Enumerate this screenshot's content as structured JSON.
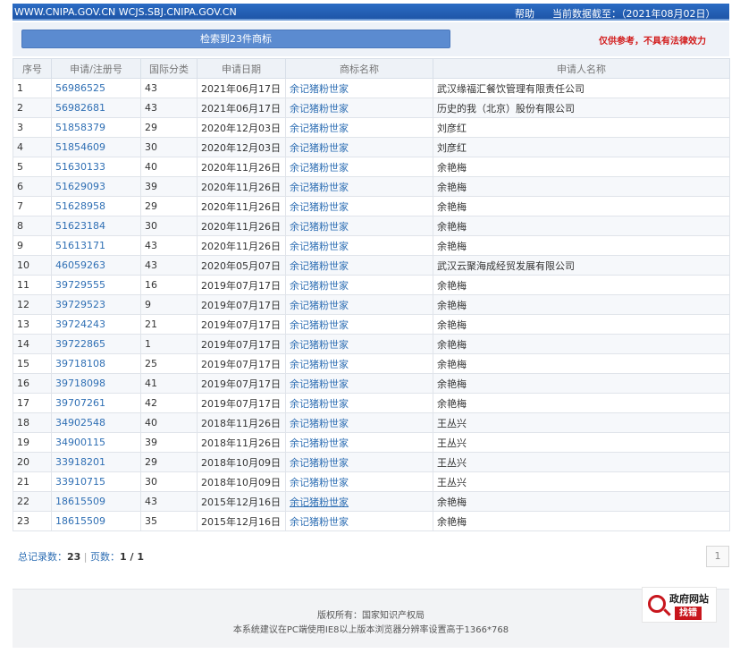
{
  "header": {
    "site": "WWW.CNIPA.GOV.CN WCJS.SBJ.CNIPA.GOV.CN",
    "help": "帮助",
    "as_of": "当前数据截至：（2021年08月02日）"
  },
  "search": {
    "result_label": "检索到23件商标",
    "disclaimer": "仅供参考，不具有法律效力"
  },
  "table": {
    "headers": [
      "序号",
      "申请/注册号",
      "国际分类",
      "申请日期",
      "商标名称",
      "申请人名称"
    ],
    "rows": [
      [
        "1",
        "56986525",
        "43",
        "2021年06月17日",
        "余记猪粉世家",
        "武汉缘福汇餐饮管理有限责任公司"
      ],
      [
        "2",
        "56982681",
        "43",
        "2021年06月17日",
        "余记猪粉世家",
        "历史的我（北京）股份有限公司"
      ],
      [
        "3",
        "51858379",
        "29",
        "2020年12月03日",
        "余记猪粉世家",
        "刘彦红"
      ],
      [
        "4",
        "51854609",
        "30",
        "2020年12月03日",
        "余记猪粉世家",
        "刘彦红"
      ],
      [
        "5",
        "51630133",
        "40",
        "2020年11月26日",
        "余记猪粉世家",
        "余艳梅"
      ],
      [
        "6",
        "51629093",
        "39",
        "2020年11月26日",
        "余记猪粉世家",
        "余艳梅"
      ],
      [
        "7",
        "51628958",
        "29",
        "2020年11月26日",
        "余记猪粉世家",
        "余艳梅"
      ],
      [
        "8",
        "51623184",
        "30",
        "2020年11月26日",
        "余记猪粉世家",
        "余艳梅"
      ],
      [
        "9",
        "51613171",
        "43",
        "2020年11月26日",
        "余记猪粉世家",
        "余艳梅"
      ],
      [
        "10",
        "46059263",
        "43",
        "2020年05月07日",
        "余记猪粉世家",
        "武汉云聚海成经贸发展有限公司"
      ],
      [
        "11",
        "39729555",
        "16",
        "2019年07月17日",
        "余记猪粉世家",
        "余艳梅"
      ],
      [
        "12",
        "39729523",
        "9",
        "2019年07月17日",
        "余记猪粉世家",
        "余艳梅"
      ],
      [
        "13",
        "39724243",
        "21",
        "2019年07月17日",
        "余记猪粉世家",
        "余艳梅"
      ],
      [
        "14",
        "39722865",
        "1",
        "2019年07月17日",
        "余记猪粉世家",
        "余艳梅"
      ],
      [
        "15",
        "39718108",
        "25",
        "2019年07月17日",
        "余记猪粉世家",
        "余艳梅"
      ],
      [
        "16",
        "39718098",
        "41",
        "2019年07月17日",
        "余记猪粉世家",
        "余艳梅"
      ],
      [
        "17",
        "39707261",
        "42",
        "2019年07月17日",
        "余记猪粉世家",
        "余艳梅"
      ],
      [
        "18",
        "34902548",
        "40",
        "2018年11月26日",
        "余记猪粉世家",
        "王丛兴"
      ],
      [
        "19",
        "34900115",
        "39",
        "2018年11月26日",
        "余记猪粉世家",
        "王丛兴"
      ],
      [
        "20",
        "33918201",
        "29",
        "2018年10月09日",
        "余记猪粉世家",
        "王丛兴"
      ],
      [
        "21",
        "33910715",
        "30",
        "2018年10月09日",
        "余记猪粉世家",
        "王丛兴"
      ],
      [
        "22",
        "18615509",
        "43",
        "2015年12月16日",
        "余记猪粉世家",
        "余艳梅"
      ],
      [
        "23",
        "18615509",
        "35",
        "2015年12月16日",
        "余记猪粉世家",
        "余艳梅"
      ]
    ]
  },
  "pager": {
    "total_label": "总记录数：",
    "total": "23",
    "sep": " | ",
    "pages_label": "页数：",
    "pages": "1 / 1",
    "current_page": "1"
  },
  "footer": {
    "copyright": "版权所有：国家知识产权局",
    "note": "本系统建议在PC端使用IE8以上版本浏览器分辨率设置高于1366*768"
  },
  "badge": {
    "title": "政府网站",
    "action": "找错"
  },
  "colors": {
    "topbar": "#1f56a8",
    "link": "#2f6fb4",
    "disclaimer": "#d21c1c",
    "button": "#5b8bd0"
  }
}
